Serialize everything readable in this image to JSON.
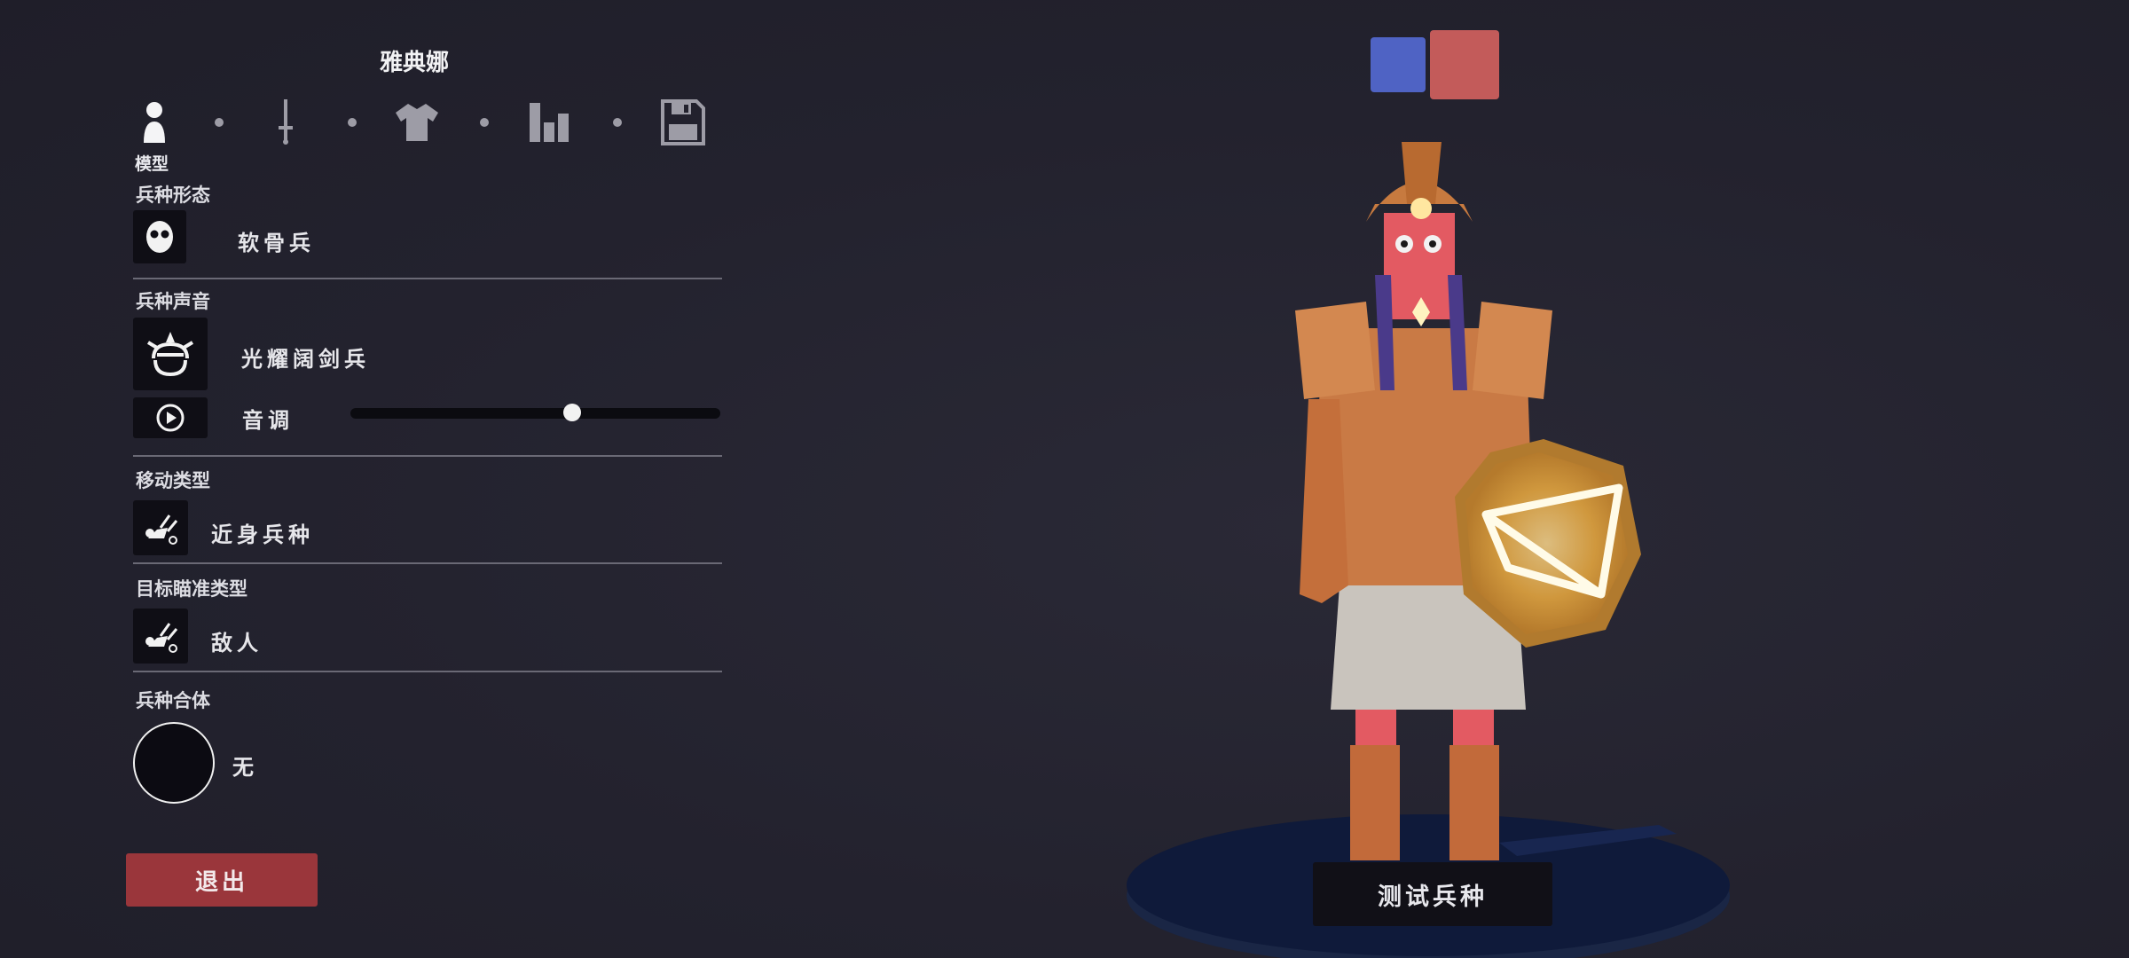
{
  "unit_name": "雅典娜",
  "tabs": [
    {
      "icon": "person-icon",
      "caption": "模型"
    },
    {
      "icon": "sword-icon"
    },
    {
      "icon": "shirt-icon"
    },
    {
      "icon": "stats-icon"
    },
    {
      "icon": "save-icon"
    }
  ],
  "sections": {
    "unit_form": {
      "title": "兵种形态",
      "value": "软骨兵",
      "icon": "mask-face-icon"
    },
    "unit_voice": {
      "title": "兵种声音",
      "value": "光耀阔剑兵",
      "icon": "helmet-face-icon",
      "pitch_label": "音调",
      "pitch_level": 0.6
    },
    "movement_type": {
      "title": "移动类型",
      "value": "近身兵种",
      "icon": "melee-icon"
    },
    "target_type": {
      "title": "目标瞄准类型",
      "value": "敌人",
      "icon": "melee-icon"
    },
    "unit_combine": {
      "title": "兵种合体",
      "value": "无"
    }
  },
  "exit_label": "退出",
  "test_unit_label": "测试兵种",
  "team_colors": {
    "blue": "#4f63c4",
    "red": "#c35b5a"
  }
}
